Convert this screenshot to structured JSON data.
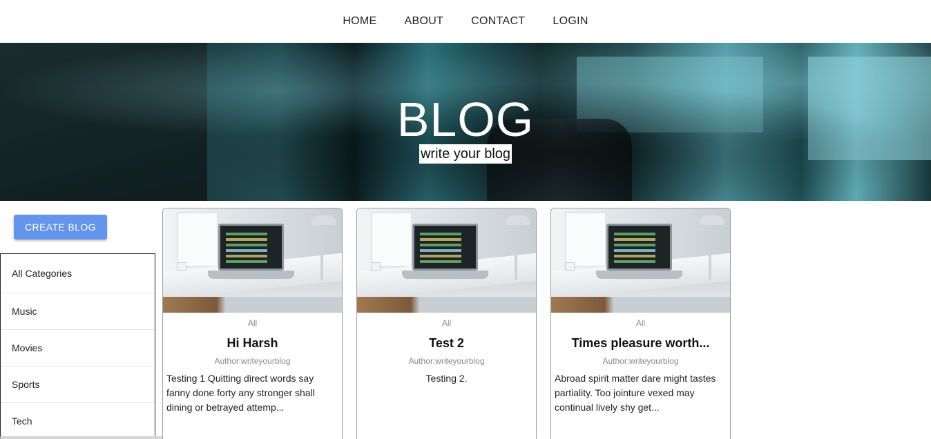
{
  "nav": {
    "items": [
      {
        "label": "HOME"
      },
      {
        "label": "ABOUT"
      },
      {
        "label": "CONTACT"
      },
      {
        "label": "LOGIN"
      }
    ]
  },
  "banner": {
    "title": "BLOG",
    "subtitle": "write your blog"
  },
  "sidebar": {
    "create_label": "CREATE BLOG",
    "categories": [
      {
        "label": "All Categories"
      },
      {
        "label": "Music"
      },
      {
        "label": "Movies"
      },
      {
        "label": "Sports"
      },
      {
        "label": "Tech"
      }
    ]
  },
  "posts": [
    {
      "category": "All",
      "title": "Hi Harsh",
      "author": "Author:writeyourblog",
      "excerpt": "Testing 1 Quitting direct words say fanny done forty any stronger shall dining or betrayed attemp..."
    },
    {
      "category": "All",
      "title": "Test 2",
      "author": "Author:writeyourblog",
      "excerpt": "Testing 2."
    },
    {
      "category": "All",
      "title": "Times pleasure worth...",
      "author": "Author:writeyourblog",
      "excerpt": "Abroad spirit matter dare might tastes partiality. Too jointure vexed may continual lively shy get..."
    }
  ],
  "colors": {
    "accent": "#6495ed",
    "muted_text": "#8a8a8a",
    "card_border": "#9e9e9e"
  }
}
